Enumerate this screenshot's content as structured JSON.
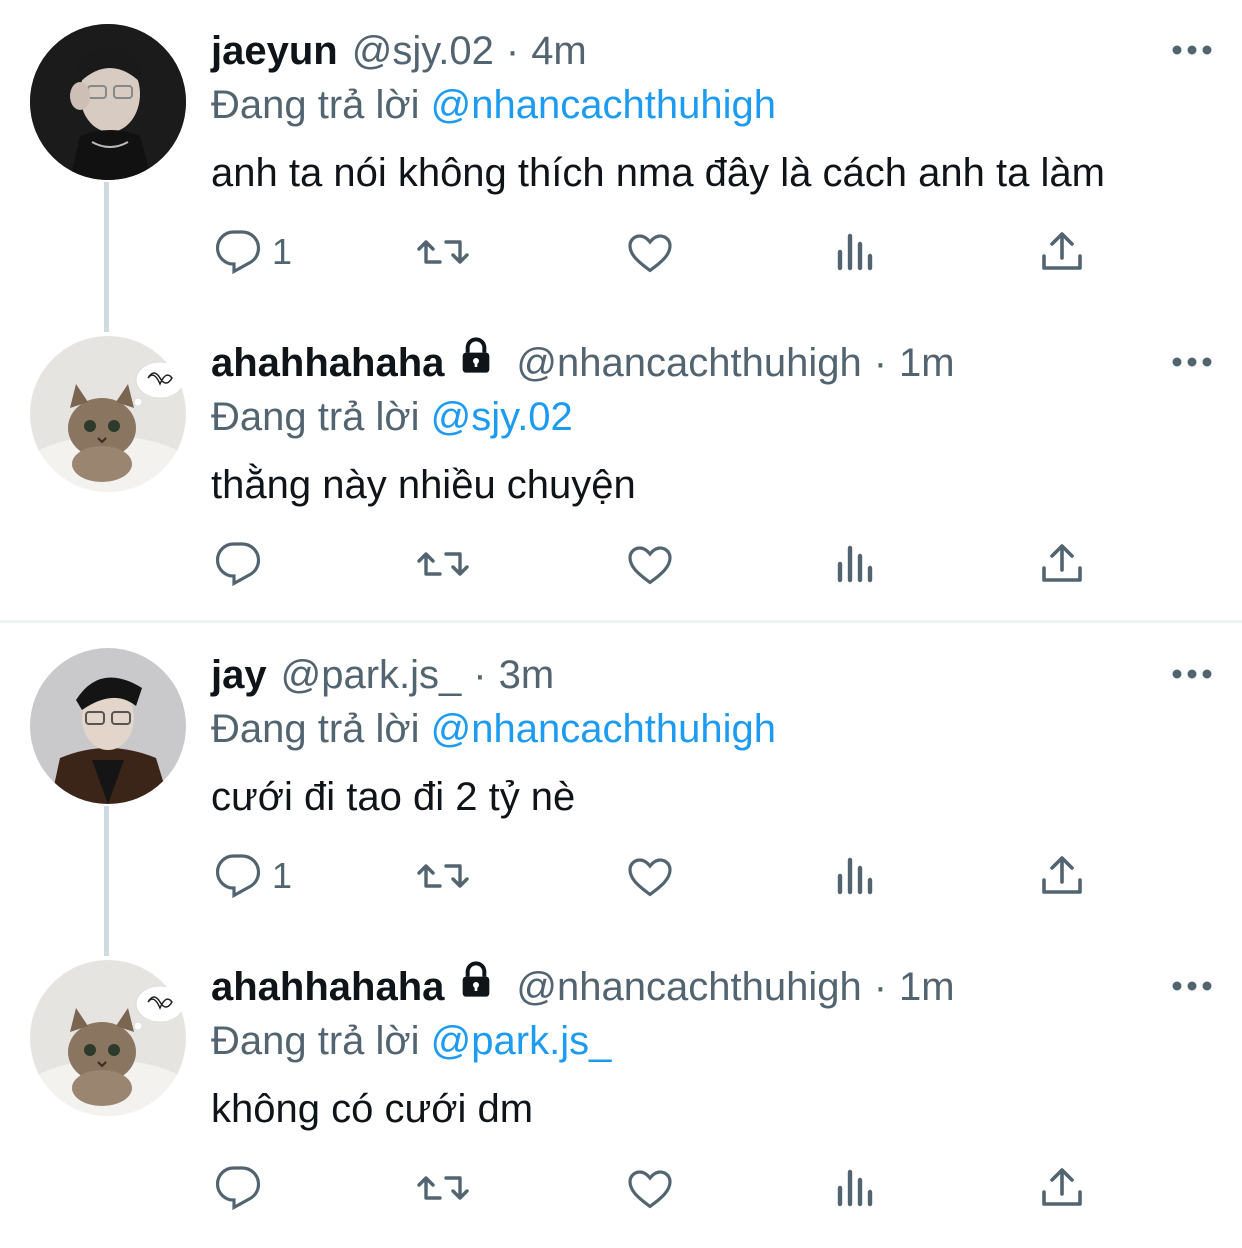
{
  "tweets": [
    {
      "name": "jaeyun",
      "handle": "@sjy.02",
      "separator": "·",
      "time": "4m",
      "locked": false,
      "reply_prefix": "Đang trả lời",
      "reply_to": "@nhancachthuhigh",
      "text": "anh ta nói không thích nma đây là cách anh ta làm",
      "reply_count": "1",
      "avatar": "man-with-glasses-photo"
    },
    {
      "name": "ahahhahaha",
      "handle": "@nhancachthuhigh",
      "separator": "·",
      "time": "1m",
      "locked": true,
      "reply_prefix": "Đang trả lời",
      "reply_to": "@sjy.02",
      "text": "thằng này nhiều chuyện",
      "reply_count": "",
      "avatar": "kitten-photo"
    },
    {
      "name": "jay",
      "handle": "@park.js_",
      "separator": "·",
      "time": "3m",
      "locked": false,
      "reply_prefix": "Đang trả lời",
      "reply_to": "@nhancachthuhigh",
      "text": "cưới đi tao đi 2 tỷ nè",
      "reply_count": "1",
      "avatar": "man-in-brown-jacket-photo"
    },
    {
      "name": "ahahhahaha",
      "handle": "@nhancachthuhigh",
      "separator": "·",
      "time": "1m",
      "locked": true,
      "reply_prefix": "Đang trả lời",
      "reply_to": "@park.js_",
      "text": "không có cưới dm",
      "reply_count": "",
      "avatar": "kitten-photo"
    }
  ],
  "icons": {
    "reply": "reply-icon",
    "retweet": "retweet-icon",
    "like": "heart-icon",
    "analytics": "analytics-icon",
    "share": "share-icon",
    "more": "more-icon",
    "lock": "lock-icon"
  },
  "colors": {
    "text": "#0f1419",
    "secondary": "#536471",
    "link": "#1d9bf0",
    "thread_line": "#cfd9de",
    "divider": "#eff3f4"
  }
}
